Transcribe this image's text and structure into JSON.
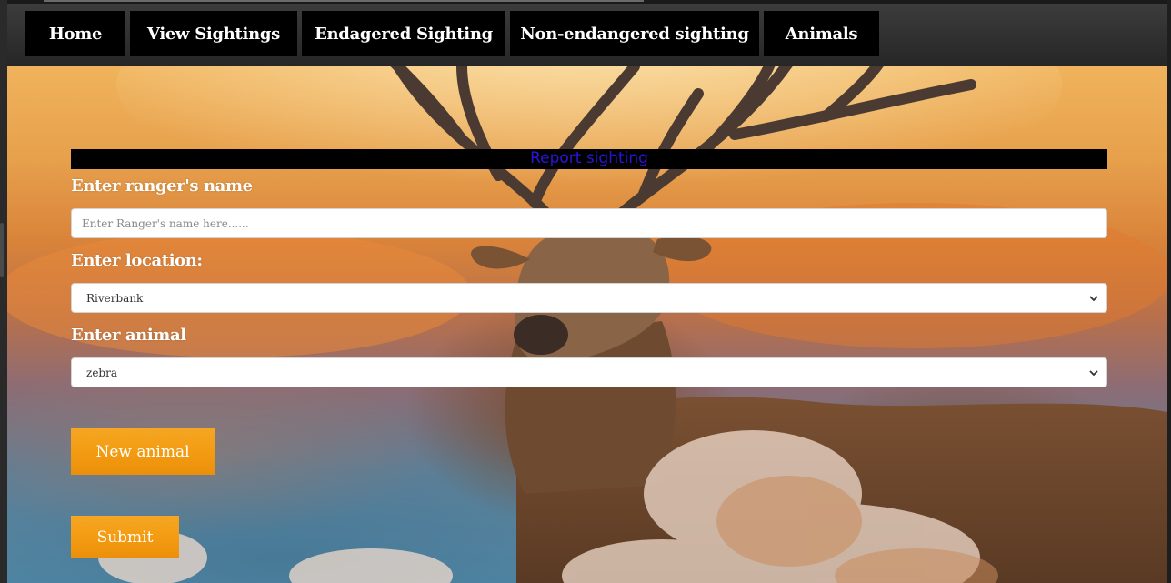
{
  "nav": {
    "items": [
      {
        "label": "Home"
      },
      {
        "label": "View Sightings"
      },
      {
        "label": "Endagered Sighting"
      },
      {
        "label": "Non-endangered sighting"
      },
      {
        "label": "Animals"
      }
    ]
  },
  "form": {
    "title": "Report sighting",
    "ranger_label": "Enter ranger's name",
    "ranger_placeholder": "Enter Ranger's name here......",
    "ranger_value": "",
    "location_label": "Enter location:",
    "location_selected": "Riverbank",
    "animal_label": "Enter animal",
    "animal_selected": "zebra",
    "new_animal_label": "New animal",
    "submit_label": "Submit"
  },
  "colors": {
    "nav_bg": "#000000",
    "banner_text": "#2b14d8",
    "button_orange": "#f39c12"
  },
  "icons": {
    "select_chevron": "chevron-down-icon"
  }
}
